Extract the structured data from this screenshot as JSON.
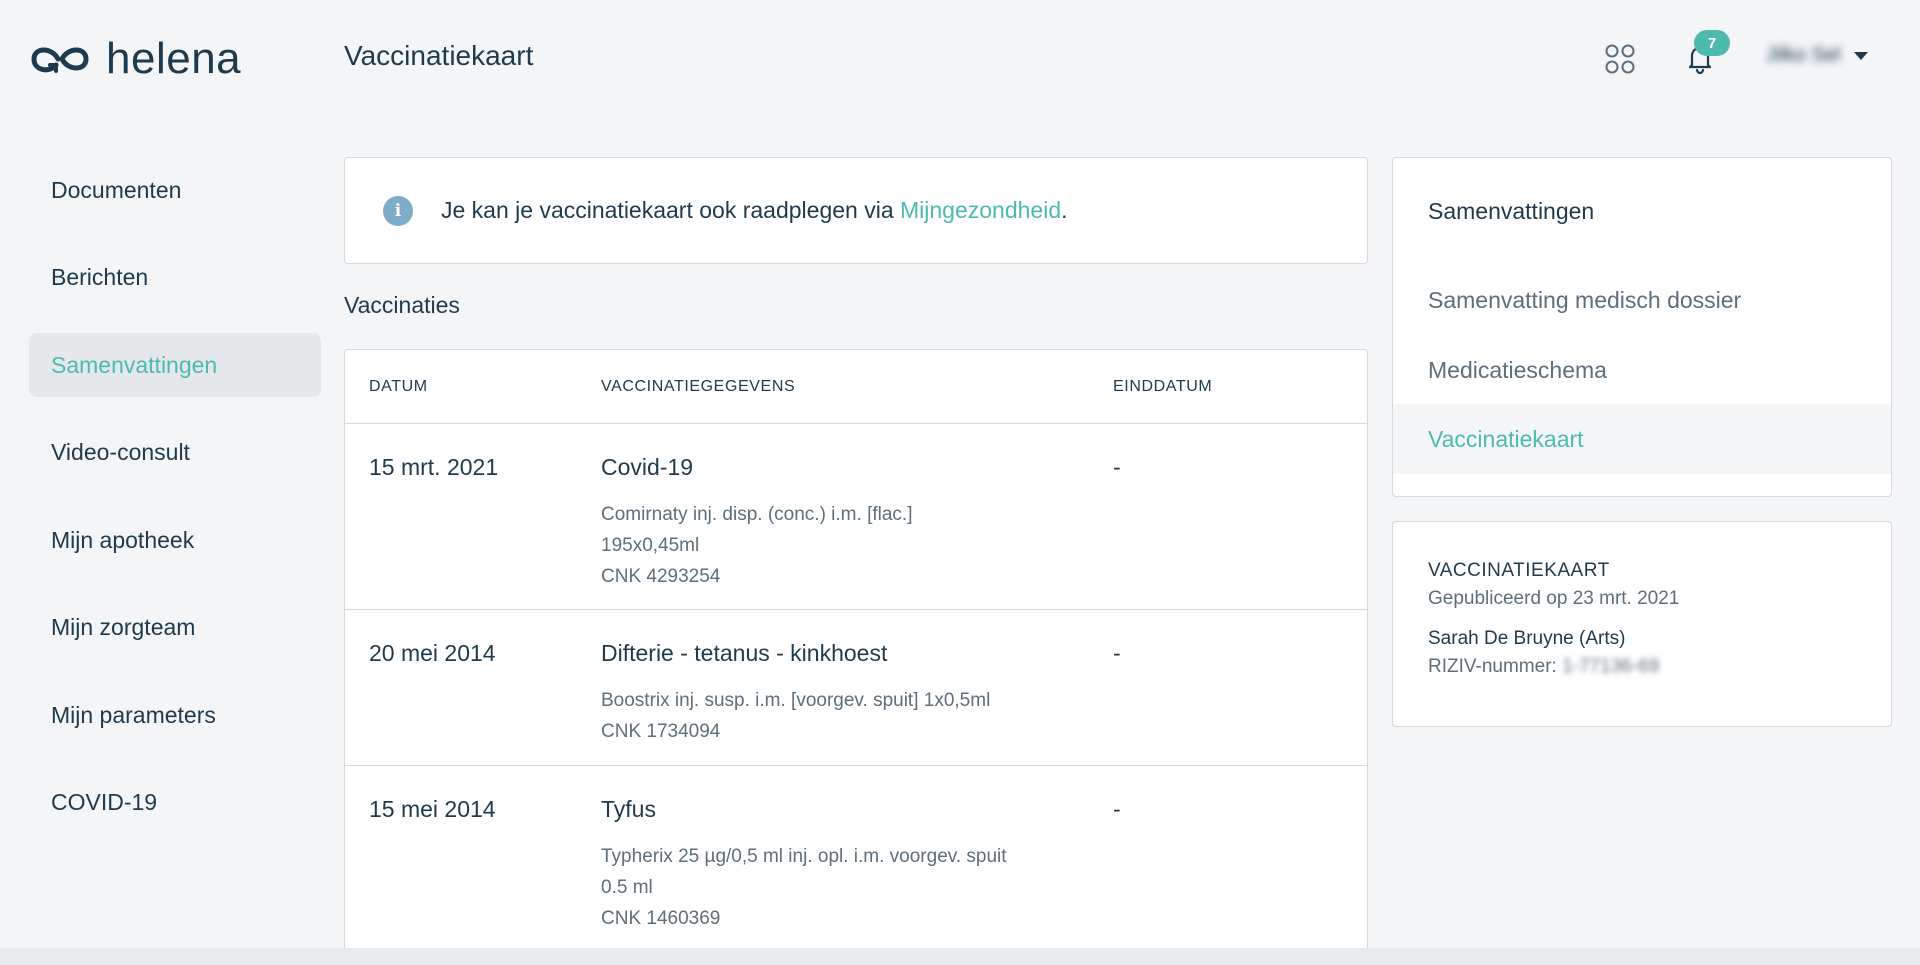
{
  "header": {
    "logo_text": "helena",
    "page_title": "Vaccinatiekaart",
    "notification_count": "7",
    "user_name": "Jilko Sel"
  },
  "sidebar": {
    "items": [
      {
        "label": "Documenten"
      },
      {
        "label": "Berichten"
      },
      {
        "label": "Samenvattingen"
      },
      {
        "label": "Video-consult"
      },
      {
        "label": "Mijn apotheek"
      },
      {
        "label": "Mijn zorgteam"
      },
      {
        "label": "Mijn parameters"
      },
      {
        "label": "COVID-19"
      }
    ],
    "active": "Samenvattingen"
  },
  "info": {
    "text_before": "Je kan je vaccinatiekaart ook raadplegen via ",
    "link": "Mijngezondheid",
    "text_after": "."
  },
  "vaccinations": {
    "title": "Vaccinaties",
    "columns": [
      "DATUM",
      "VACCINATIEGEGEVENS",
      "EINDDATUM"
    ],
    "rows": [
      {
        "date": "15 mrt. 2021",
        "name": "Covid-19",
        "details": [
          "Comirnaty inj. disp. (conc.) i.m. [flac.]",
          "195x0,45ml",
          "CNK 4293254"
        ],
        "end": "-"
      },
      {
        "date": "20 mei 2014",
        "name": "Difterie - tetanus - kinkhoest",
        "details": [
          "Boostrix inj. susp. i.m. [voorgev. spuit] 1x0,5ml",
          "CNK 1734094"
        ],
        "end": "-"
      },
      {
        "date": "15 mei 2014",
        "name": "Tyfus",
        "details": [
          "Typherix 25 µg/0,5 ml inj. opl. i.m. voorgev. spuit",
          "0.5 ml",
          "CNK 1460369"
        ],
        "end": "-"
      }
    ]
  },
  "summaries": {
    "title": "Samenvattingen",
    "items": [
      {
        "label": "Samenvatting medisch dossier"
      },
      {
        "label": "Medicatieschema"
      },
      {
        "label": "Vaccinatiekaart"
      }
    ],
    "active": "Vaccinatiekaart"
  },
  "card": {
    "label": "VACCINATIEKAART",
    "published": "Gepubliceerd op 23 mrt. 2021",
    "author": "Sarah De Bruyne (Arts)",
    "riziv_label": "RIZIV-nummer: ",
    "riziv_value": "1-77136-69"
  },
  "colors": {
    "accent": "#4dbab0",
    "text": "#1f3a4c",
    "muted": "#5d6f7c",
    "background": "#f3f5f7"
  }
}
